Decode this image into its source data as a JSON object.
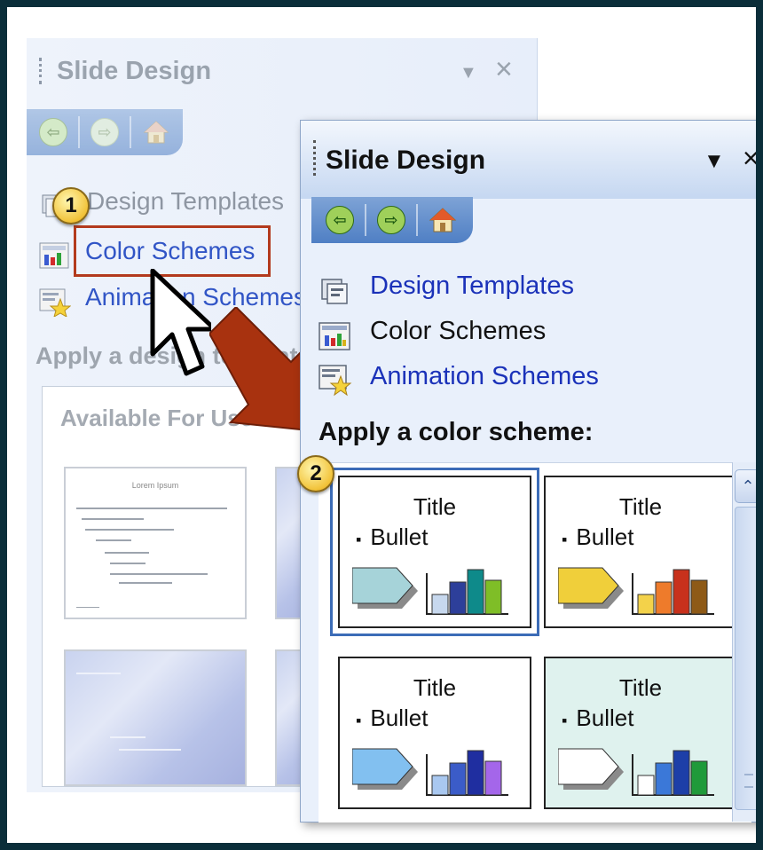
{
  "back_pane": {
    "title": "Slide Design",
    "dropdown_glyph": "▼",
    "close_glyph": "×",
    "nav": {
      "back_icon": "back-arrow-icon",
      "forward_icon": "forward-arrow-icon",
      "home_icon": "home-icon"
    },
    "links": [
      {
        "label": "Design Templates",
        "icon": "design-templates-icon"
      },
      {
        "label": "Color Schemes",
        "icon": "color-schemes-icon"
      },
      {
        "label": "Animation Schemes",
        "icon": "animation-schemes-icon"
      }
    ],
    "heading": "Apply a design template:",
    "available_heading": "Available For Use",
    "thumb_title": "Lorem Ipsum"
  },
  "callouts": {
    "step1": "1",
    "step2": "2"
  },
  "front_pane": {
    "title": "Slide Design",
    "dropdown_glyph": "▼",
    "close_glyph": "×",
    "nav": {
      "back_icon": "back-arrow-icon",
      "forward_icon": "forward-arrow-icon",
      "home_icon": "home-icon"
    },
    "links": [
      {
        "label": "Design Templates",
        "icon": "design-templates-icon"
      },
      {
        "label": "Color Schemes",
        "icon": "color-schemes-icon"
      },
      {
        "label": "Animation Schemes",
        "icon": "animation-schemes-icon"
      }
    ],
    "heading": "Apply a color scheme:",
    "schemes": [
      {
        "title": "Title",
        "bullet": "Bullet",
        "selected": true,
        "colors": {
          "card_bg": "#ffffff",
          "shape": "#a6d3d9",
          "bars": [
            "#c7d8ee",
            "#2d3f9a",
            "#0e8a8a",
            "#7fbe27"
          ]
        }
      },
      {
        "title": "Title",
        "bullet": "Bullet",
        "selected": false,
        "colors": {
          "card_bg": "#ffffff",
          "shape": "#f0cf3a",
          "bars": [
            "#f3d24a",
            "#ee7b2b",
            "#c8311c",
            "#8e5a17"
          ]
        }
      },
      {
        "title": "Title",
        "bullet": "Bullet",
        "selected": false,
        "colors": {
          "card_bg": "#ffffff",
          "shape": "#82c0f0",
          "bars": [
            "#a9c8f0",
            "#3b5cc8",
            "#1f2ea0",
            "#a466ea"
          ]
        }
      },
      {
        "title": "Title",
        "bullet": "Bullet",
        "selected": false,
        "colors": {
          "card_bg": "#dff2ee",
          "shape": "#ffffff",
          "bars": [
            "#ffffff",
            "#3b78d8",
            "#1d3fa8",
            "#1f9a3a"
          ]
        }
      }
    ]
  },
  "annotations": {
    "arrow_color": "#a8320f",
    "highlight_color": "#b33a1d"
  }
}
